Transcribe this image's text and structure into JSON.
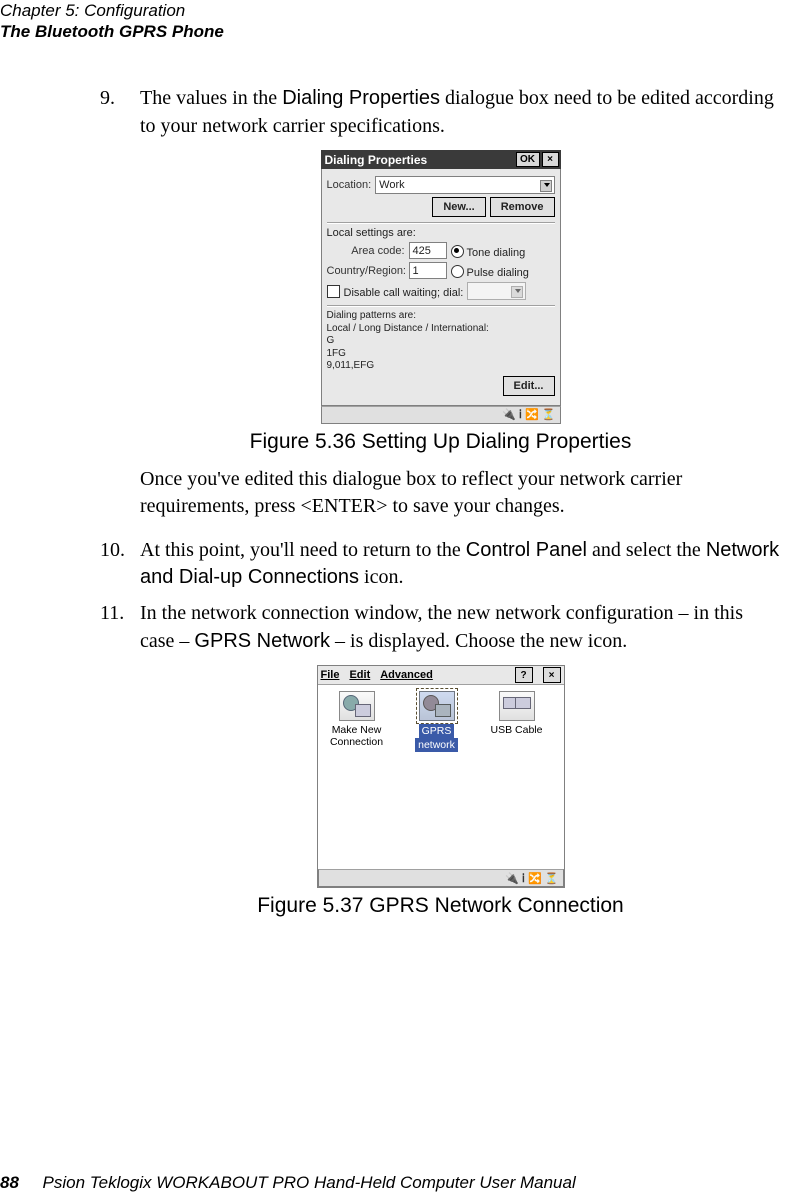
{
  "header": {
    "chapter_line": "Chapter 5: Configuration",
    "section_line": "The Bluetooth GPRS Phone"
  },
  "step9": {
    "num": "9.",
    "before": "The values in the ",
    "bold1": "Dialing Properties",
    "after": " dialogue box need to be edited according to your network carrier specifications."
  },
  "fig536": {
    "title": "Dialing Properties",
    "ok": "OK",
    "close": "×",
    "location_label": "Location:",
    "location_value": "Work",
    "new_btn": "New...",
    "remove_btn": "Remove",
    "local_settings": "Local settings are:",
    "area_label": "Area code:",
    "area_value": "425",
    "country_label": "Country/Region:",
    "country_value": "1",
    "tone_label": "Tone dialing",
    "pulse_label": "Pulse dialing",
    "disable_label": "Disable call waiting; dial:",
    "patterns_hdr": "Dialing patterns are:",
    "patterns_sub": "Local / Long Distance / International:",
    "p1": "G",
    "p2": "1FG",
    "p3": "9,011,EFG",
    "edit_btn": "Edit...",
    "tray": "🔌 ⅰ 🔀 ⏳"
  },
  "figcap536": "Figure 5.36 Setting Up Dialing Properties",
  "para_after536": {
    "t1": "Once you've edited this dialogue box to reflect your network carrier requirements, press <ENTER> to save your changes."
  },
  "step10": {
    "num": "10.",
    "t1": "At this point, you'll need to return to the ",
    "b1": "Control Panel",
    "t2": " and select the ",
    "b2": "Network and Dial-up Connections",
    "t3": " icon."
  },
  "step11": {
    "num": "11.",
    "t1": "In the network connection window, the new network configuration – in this case – ",
    "b1": "GPRS Network",
    "t2": " – is displayed. Choose the new icon."
  },
  "fig537": {
    "menu_file": "File",
    "menu_edit": "Edit",
    "menu_adv": "Advanced",
    "q": "?",
    "x": "×",
    "icon1a": "Make New",
    "icon1b": "Connection",
    "icon2a": "GPRS",
    "icon2b": "network",
    "icon3": "USB Cable",
    "tray": "🔌 ⅰ 🔀 ⏳"
  },
  "figcap537": "Figure 5.37 GPRS Network Connection",
  "footer": {
    "page": "88",
    "title": "Psion Teklogix WORKABOUT PRO Hand-Held Computer User Manual"
  }
}
